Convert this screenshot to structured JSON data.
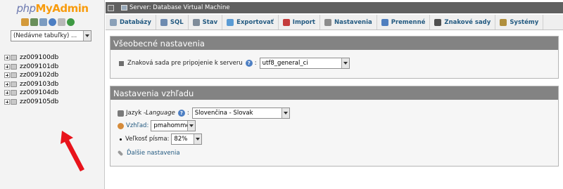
{
  "logo": {
    "php": "php",
    "my": "My",
    "admin": "Admin"
  },
  "nav": {
    "icons": [
      "home-icon",
      "database-icon",
      "sql-icon",
      "help-icon",
      "docs-icon",
      "reload-icon"
    ],
    "recent_select": "(Nedávne tabuľky) ...",
    "databases": [
      "zz009100db",
      "zz009101db",
      "zz009102db",
      "zz009103db",
      "zz009104db",
      "zz009105db"
    ]
  },
  "serverbar": {
    "title": "Server: Database Virtual Machine"
  },
  "tabs": [
    {
      "label": "Databázy",
      "icon": "databases-icon",
      "color": "#8aa0b8"
    },
    {
      "label": "SQL",
      "icon": "sql-icon",
      "color": "#6e8bb0"
    },
    {
      "label": "Stav",
      "icon": "status-icon",
      "color": "#7f8c9a"
    },
    {
      "label": "Exportovať",
      "icon": "export-icon",
      "color": "#5a9bd4"
    },
    {
      "label": "Import",
      "icon": "import-icon",
      "color": "#c43c3c"
    },
    {
      "label": "Nastavenia",
      "icon": "wrench-icon",
      "color": "#8c8c8c"
    },
    {
      "label": "Premenné",
      "icon": "variables-icon",
      "color": "#4f7fbf"
    },
    {
      "label": "Znakové sady",
      "icon": "charset-icon",
      "color": "#505050"
    },
    {
      "label": "Systémy",
      "icon": "engines-icon",
      "color": "#b08f3d"
    }
  ],
  "general": {
    "title": "Všeobecné nastavenia",
    "collation_label": "Znaková sada pre pripojenie k serveru",
    "collation_value": "utf8_general_ci"
  },
  "appearance": {
    "title": "Nastavenia vzhľadu",
    "language_label": "Jazyk - ",
    "language_label_italic": "Language",
    "language_value": "Slovenčina - Slovak",
    "theme_label": "Vzhľad:",
    "theme_value": "pmahomme",
    "fontsize_label": "Veľkosť písma:",
    "fontsize_value": "82%",
    "more_settings": "Ďalšie nastavenia"
  },
  "colors": {
    "tab_text": "#235a81",
    "header_bg": "#838383",
    "arrow": "#e8131b"
  }
}
